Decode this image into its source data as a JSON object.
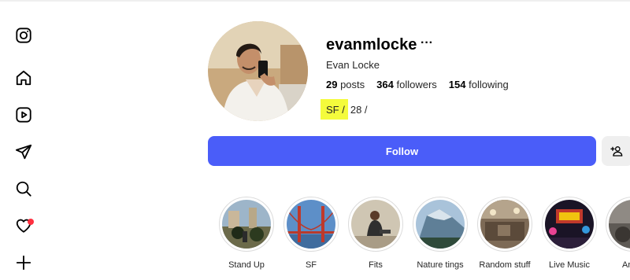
{
  "sidebar": {
    "items": [
      {
        "icon": "instagram-icon"
      },
      {
        "icon": "home-icon"
      },
      {
        "icon": "reels-icon"
      },
      {
        "icon": "send-icon"
      },
      {
        "icon": "search-icon"
      },
      {
        "icon": "heart-icon",
        "badge": true
      },
      {
        "icon": "plus-icon"
      }
    ]
  },
  "profile": {
    "username": "evanmlocke",
    "more": "···",
    "full_name": "Evan Locke",
    "stats": {
      "posts_count": "29",
      "posts_label": " posts",
      "followers_count": "364",
      "followers_label": " followers",
      "following_count": "154",
      "following_label": " following"
    },
    "bio_highlighted": "SF /",
    "bio_rest": "28 /"
  },
  "actions": {
    "follow_label": "Follow",
    "suggest_icon": "person-add-icon"
  },
  "highlights": [
    {
      "label": "Stand Up"
    },
    {
      "label": "SF"
    },
    {
      "label": "Fits"
    },
    {
      "label": "Nature tings"
    },
    {
      "label": "Random stuff"
    },
    {
      "label": "Live Music"
    },
    {
      "label": "Ar"
    }
  ],
  "colors": {
    "follow_button": "#4a5df9",
    "bio_highlight": "#f4fb3c",
    "notification_dot": "#ff3040"
  }
}
